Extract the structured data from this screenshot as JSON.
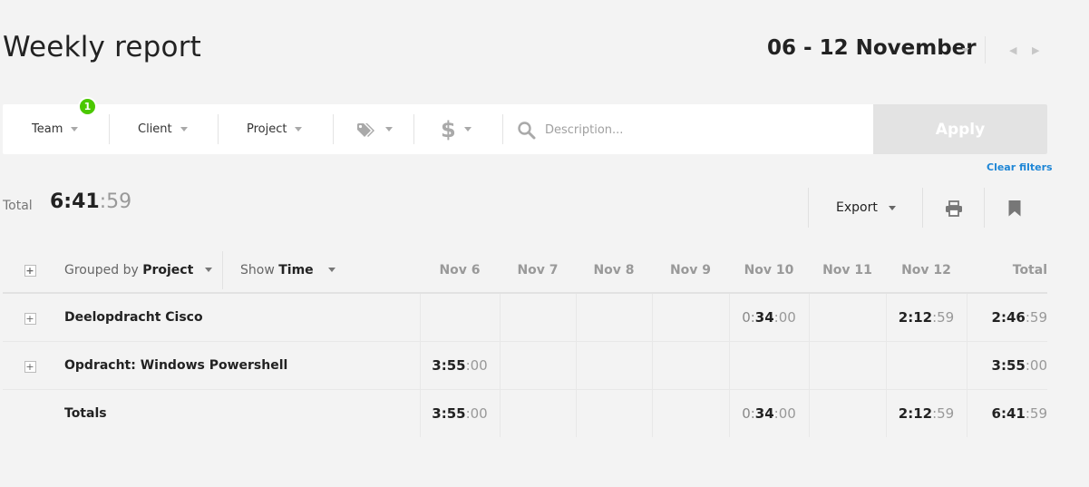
{
  "header": {
    "title": "Weekly report",
    "date_range": "06 - 12 November"
  },
  "filters": {
    "team_label": "Team",
    "team_badge": "1",
    "client_label": "Client",
    "project_label": "Project",
    "tags_icon": "tag-icon",
    "billable_icon": "dollar-icon",
    "description_placeholder": "Description...",
    "apply_label": "Apply",
    "clear_label": "Clear filters"
  },
  "summary": {
    "total_label": "Total",
    "total_main": "6:41",
    "total_sec": ":59",
    "export_label": "Export"
  },
  "table": {
    "group_prefix": "Grouped by",
    "group_value": "Project",
    "show_prefix": "Show",
    "show_value": "Time",
    "days": [
      "Nov 6",
      "Nov 7",
      "Nov 8",
      "Nov 9",
      "Nov 10",
      "Nov 11",
      "Nov 12"
    ],
    "total_header": "Total",
    "rows": [
      {
        "name": "Deelopdracht Cisco",
        "cells": [
          null,
          null,
          null,
          null,
          {
            "lead": "0:",
            "main": "34",
            "sec": ":00"
          },
          null,
          {
            "lead": "",
            "main": "2:12",
            "sec": ":59"
          }
        ],
        "total": {
          "main": "2:46",
          "sec": ":59"
        }
      },
      {
        "name": "Opdracht: Windows Powershell",
        "cells": [
          {
            "lead": "",
            "main": "3:55",
            "sec": ":00"
          },
          null,
          null,
          null,
          null,
          null,
          null
        ],
        "total": {
          "main": "3:55",
          "sec": ":00"
        }
      }
    ],
    "totals": {
      "label": "Totals",
      "cells": [
        {
          "lead": "",
          "main": "3:55",
          "sec": ":00"
        },
        null,
        null,
        null,
        {
          "lead": "0:",
          "main": "34",
          "sec": ":00"
        },
        null,
        {
          "lead": "",
          "main": "2:12",
          "sec": ":59"
        }
      ],
      "total": {
        "main": "6:41",
        "sec": ":59"
      }
    }
  },
  "colors": {
    "badge": "#4bc800",
    "link": "#1e86d6",
    "apply_disabled": "#e3e3e3"
  }
}
